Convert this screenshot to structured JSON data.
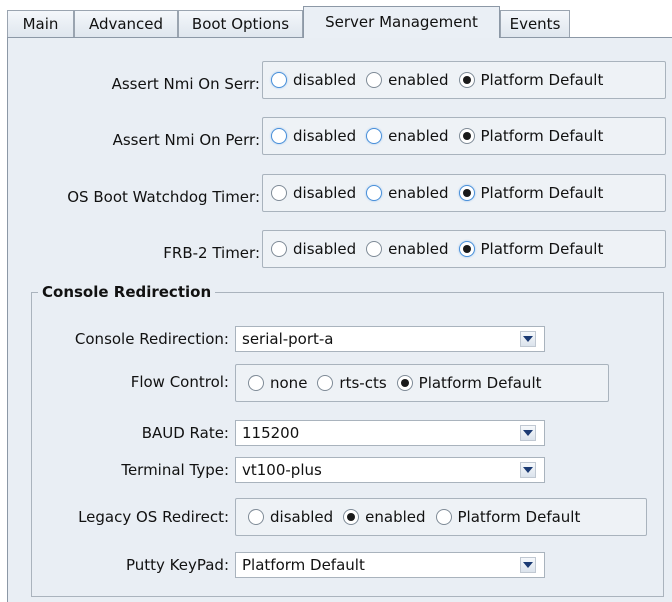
{
  "tabs": [
    {
      "label": "Main",
      "active": false
    },
    {
      "label": "Advanced",
      "active": false
    },
    {
      "label": "Boot Options",
      "active": false
    },
    {
      "label": "Server Management",
      "active": true
    },
    {
      "label": "Events",
      "active": false
    }
  ],
  "server_settings": [
    {
      "label": "Assert Nmi On Serr:",
      "options": [
        "disabled",
        "enabled",
        "Platform Default"
      ],
      "selected": "Platform Default"
    },
    {
      "label": "Assert Nmi On Perr:",
      "options": [
        "disabled",
        "enabled",
        "Platform Default"
      ],
      "selected": "Platform Default"
    },
    {
      "label": "OS Boot Watchdog Timer:",
      "options": [
        "disabled",
        "enabled",
        "Platform Default"
      ],
      "selected": "Platform Default"
    },
    {
      "label": "FRB-2 Timer:",
      "options": [
        "disabled",
        "enabled",
        "Platform Default"
      ],
      "selected": "Platform Default"
    }
  ],
  "console_redirection": {
    "legend": "Console Redirection",
    "console_redirection": {
      "label": "Console Redirection:",
      "value": "serial-port-a"
    },
    "flow_control": {
      "label": "Flow Control:",
      "options": [
        "none",
        "rts-cts",
        "Platform Default"
      ],
      "selected": "Platform Default"
    },
    "baud_rate": {
      "label": "BAUD Rate:",
      "value": "115200"
    },
    "terminal_type": {
      "label": "Terminal Type:",
      "value": "vt100-plus"
    },
    "legacy_os_redirect": {
      "label": "Legacy OS Redirect:",
      "options": [
        "disabled",
        "enabled",
        "Platform Default"
      ],
      "selected": "enabled"
    },
    "putty_keypad": {
      "label": "Putty KeyPad:",
      "value": "Platform Default"
    }
  },
  "colors": {
    "panel_bg": "#e9eef4",
    "focus_ring": "#4a90d9"
  }
}
